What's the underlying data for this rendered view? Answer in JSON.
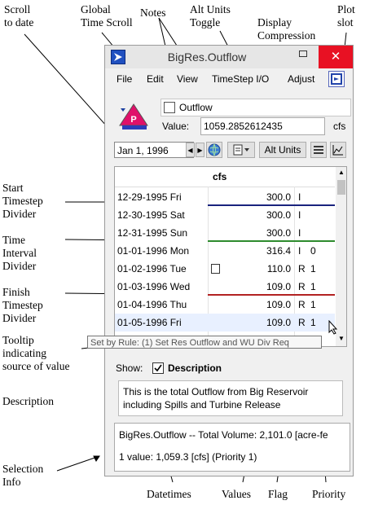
{
  "annotations": {
    "scroll_to_date": "Scroll\nto date",
    "global_time_scroll": "Global\nTime Scroll",
    "notes": "Notes",
    "alt_units_toggle": "Alt Units\nToggle",
    "display_compression": "Display\nCompression",
    "plot_slot": "Plot\nslot",
    "start_timestep_divider": "Start\nTimestep\nDivider",
    "time_interval_divider": "Time\nInterval\nDivider",
    "finish_timestep_divider": "Finish\nTimestep\nDivider",
    "tooltip_source": "Tooltip\nindicating\nsource of value",
    "description": "Description",
    "selection_info": "Selection\nInfo",
    "datetimes": "Datetimes",
    "values": "Values",
    "flag": "Flag",
    "priority": "Priority"
  },
  "window": {
    "title": "BigRes.Outflow",
    "minimize_symbol": "",
    "close_symbol": "✕",
    "accent": "#e81123"
  },
  "menu": [
    "File",
    "Edit",
    "View",
    "TimeStep I/O",
    "Adjust"
  ],
  "slot": {
    "name": "Outflow",
    "value_label": "Value:",
    "value": "1059.2852612435",
    "units": "cfs",
    "picture_letter": "P"
  },
  "toolbar": {
    "date": "Jan 1, 1996",
    "alt_units_label": "Alt Units"
  },
  "table": {
    "column_header": "cfs",
    "rows": [
      {
        "date": "12-29-1995 Fri",
        "value": "300.0",
        "flag": "I",
        "priority": ""
      },
      {
        "date": "12-30-1995 Sat",
        "value": "300.0",
        "flag": "I",
        "priority": ""
      },
      {
        "date": "12-31-1995 Sun",
        "value": "300.0",
        "flag": "I",
        "priority": ""
      },
      {
        "date": "01-01-1996 Mon",
        "value": "316.4",
        "flag": "I",
        "priority": "0"
      },
      {
        "date": "01-02-1996 Tue",
        "value": "110.0",
        "flag": "R",
        "priority": "1"
      },
      {
        "date": "01-03-1996 Wed",
        "value": "109.0",
        "flag": "R",
        "priority": "1"
      },
      {
        "date": "01-04-1996 Thu",
        "value": "109.0",
        "flag": "R",
        "priority": "1"
      },
      {
        "date": "01-05-1996 Fri",
        "value": "109.0",
        "flag": "R",
        "priority": "1"
      }
    ],
    "divider_colors": {
      "start": "#1a237e",
      "interval": "#2e8b2e",
      "finish": "#b22222"
    }
  },
  "tooltip": "Set by Rule: (1) Set Res Outflow and WU Div Req",
  "show": {
    "label": "Show:",
    "checkbox_label": "Description",
    "checked": true
  },
  "description_text": "This is the total Outflow from Big Reservoir including Spills and Turbine Release",
  "selection_info": {
    "line1": "BigRes.Outflow -- Total Volume: 2,101.0 [acre-fe",
    "line2": "1 value:  1,059.3 [cfs]  (Priority 1)"
  }
}
